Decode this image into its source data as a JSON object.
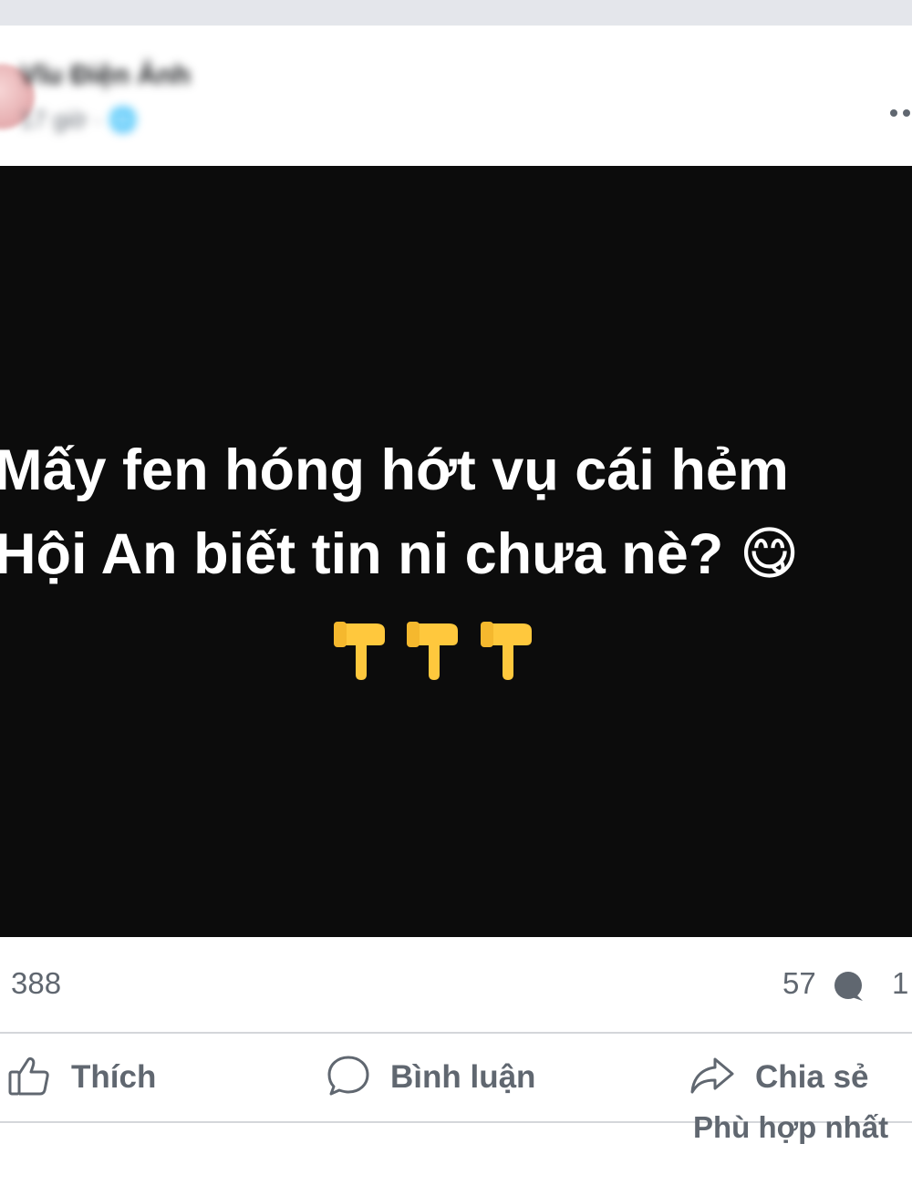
{
  "post": {
    "author_name": "Vĩu Điện Ảnh",
    "meta": "17 giờ · 🌐",
    "caption_lines": [
      "Mấy fen hóng hớt vụ cái hẻm",
      "Hội An biết tin ni chưa nè? 😋"
    ]
  },
  "stats": {
    "reactions": "388",
    "comments": "57",
    "shares": "1"
  },
  "actions": {
    "like": "Thích",
    "comment": "Bình luận",
    "share": "Chia sẻ"
  },
  "sort": {
    "label": "Phù hợp nhất"
  },
  "icons": {
    "more": "more-options-icon",
    "like": "thumbs-up-icon",
    "comment": "comment-bubble-icon",
    "share": "share-arrow-icon",
    "emoji_row": [
      "pointing-down-hand-emoji",
      "pointing-down-hand-emoji",
      "pointing-down-hand-emoji"
    ]
  },
  "colors": {
    "background": "#e9ebee",
    "card": "#ffffff",
    "image_background": "#0c0c0c",
    "secondary_text": "#606770",
    "divider": "#d4d6da"
  }
}
